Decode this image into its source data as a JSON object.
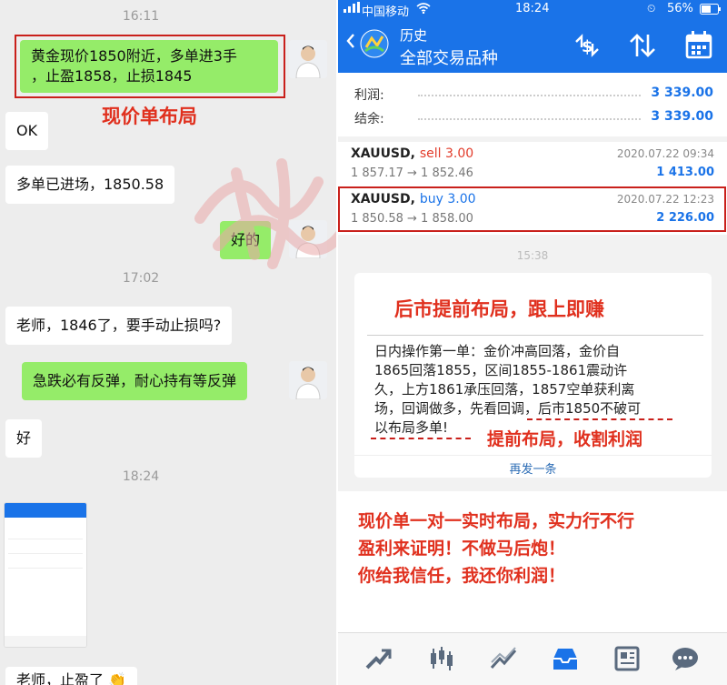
{
  "chat": {
    "times": [
      "16:11",
      "17:02",
      "18:24"
    ],
    "messages": [
      {
        "side": "me",
        "lines": [
          "黄金现价1850附近，多单进3手",
          "，止盈1858，止损1845"
        ]
      },
      {
        "side": "other",
        "text": "OK"
      },
      {
        "side": "other",
        "text": "多单已进场，1850.58"
      },
      {
        "side": "me",
        "text": "好的"
      },
      {
        "side": "other",
        "text": "老师，1846了，要手动止损吗?"
      },
      {
        "side": "me",
        "text": "急跌必有反弹，耐心持有等反弹"
      },
      {
        "side": "other",
        "text": "好"
      },
      {
        "side": "other",
        "text": "老师，止盈了 👏"
      }
    ],
    "annotation": "现价单布局"
  },
  "app": {
    "status": {
      "carrier": "中国移动",
      "time": "18:24",
      "battery": "56%"
    },
    "header": {
      "line1": "历史",
      "line2": "全部交易品种"
    },
    "summary": [
      {
        "label": "利润:",
        "value": "3 339.00"
      },
      {
        "label": "结余:",
        "value": "3 339.00"
      }
    ],
    "trades": [
      {
        "symbol": "XAUUSD,",
        "side": "sell 3.00",
        "prices": "1 857.17 → 1 852.46",
        "date": "2020.07.22 09:34",
        "pnl": "1 413.00"
      },
      {
        "symbol": "XAUUSD,",
        "side": "buy 3.00",
        "prices": "1 850.58 → 1 858.00",
        "date": "2020.07.22 12:23",
        "pnl": "2 226.00"
      }
    ],
    "card_time": "15:38",
    "card": {
      "title": "后市提前布局，跟上即赚",
      "body": [
        "日内操作第一单：金价冲高回落，金价自",
        "1865回落1855，区间1855-1861震动许",
        "久，上方1861承压回落，1857空单获利离",
        "场，回调做多，先看回调，后市1850不破可",
        "以布局多单!"
      ],
      "annotation": "提前布局，收割利润",
      "more": "再发一条"
    },
    "slogan": [
      "现价单一对一实时布局，实力行不行",
      "盈利来证明！不做马后炮！",
      "你给我信任，我还你利润！"
    ]
  },
  "colors": {
    "accent": "#1a73e8",
    "bubble_me": "#95ec69",
    "annotation_red": "#e0301e"
  },
  "icons": [
    "signal-icon",
    "wifi-icon",
    "battery-icon",
    "back-icon",
    "app-logo-icon",
    "dollar-refresh-icon",
    "sort-icon",
    "calendar-icon",
    "trade-icon",
    "chart-icon",
    "line-icon",
    "history-icon",
    "news-icon",
    "chat-icon"
  ]
}
